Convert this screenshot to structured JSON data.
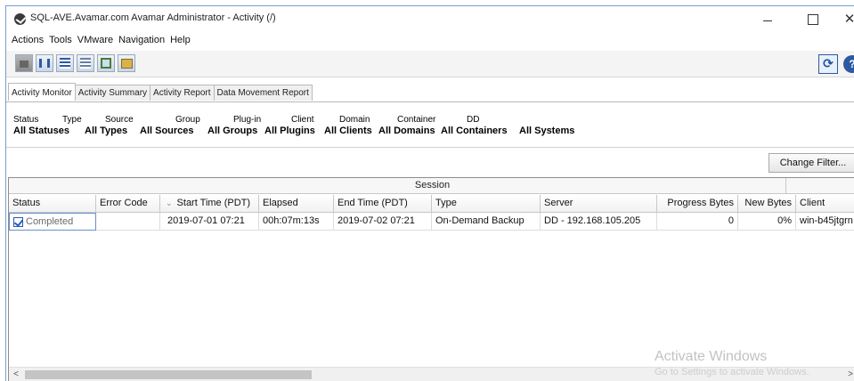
{
  "window": {
    "title": "SQL-AVE.Avamar.com Avamar Administrator - Activity (/)",
    "minimize": "",
    "maximize": "",
    "close": "✕"
  },
  "menu": [
    "Actions",
    "Tools",
    "VMware",
    "Navigation",
    "Help"
  ],
  "toolbar": {
    "refresh_icon": "refresh-icon",
    "help_icon": "help-icon",
    "help_label": "?"
  },
  "tabs": [
    {
      "label": "Activity Monitor",
      "active": true
    },
    {
      "label": "Activity Summary",
      "active": false
    },
    {
      "label": "Activity Report",
      "active": false
    },
    {
      "label": "Data Movement Report",
      "active": false
    }
  ],
  "filters": [
    {
      "label": "Status",
      "value": "All Statuses"
    },
    {
      "label": "Type",
      "value": "All Types"
    },
    {
      "label": "Source",
      "value": "All Sources"
    },
    {
      "label": "Group",
      "value": "All Groups"
    },
    {
      "label": "Plug-in",
      "value": "All Plugins"
    },
    {
      "label": "Client",
      "value": "All Clients"
    },
    {
      "label": "Domain",
      "value": "All Domains"
    },
    {
      "label": "Container",
      "value": "All Containers"
    },
    {
      "label": "DD",
      "value": "All Systems"
    }
  ],
  "change_filter_label": "Change Filter...",
  "table": {
    "group_header": "Session",
    "columns": [
      "Status",
      "Error Code",
      "Start Time (PDT)",
      "Elapsed",
      "End Time (PDT)",
      "Type",
      "Server",
      "Progress Bytes",
      "New Bytes",
      "Client"
    ],
    "rows": [
      [
        "Completed",
        "",
        "2019-07-01 07:21",
        "00h:07m:13s",
        "2019-07-02 07:21",
        "On-Demand Backup",
        "DD - 192.168.105.205",
        "0",
        "0%",
        "win-b45jtgrn"
      ]
    ]
  },
  "watermark": {
    "title": "Activate Windows",
    "subtitle": "Go to Settings to activate Windows."
  },
  "colors": {
    "accent": "#2c5aa0",
    "selection_border": "#6a8fcf"
  }
}
